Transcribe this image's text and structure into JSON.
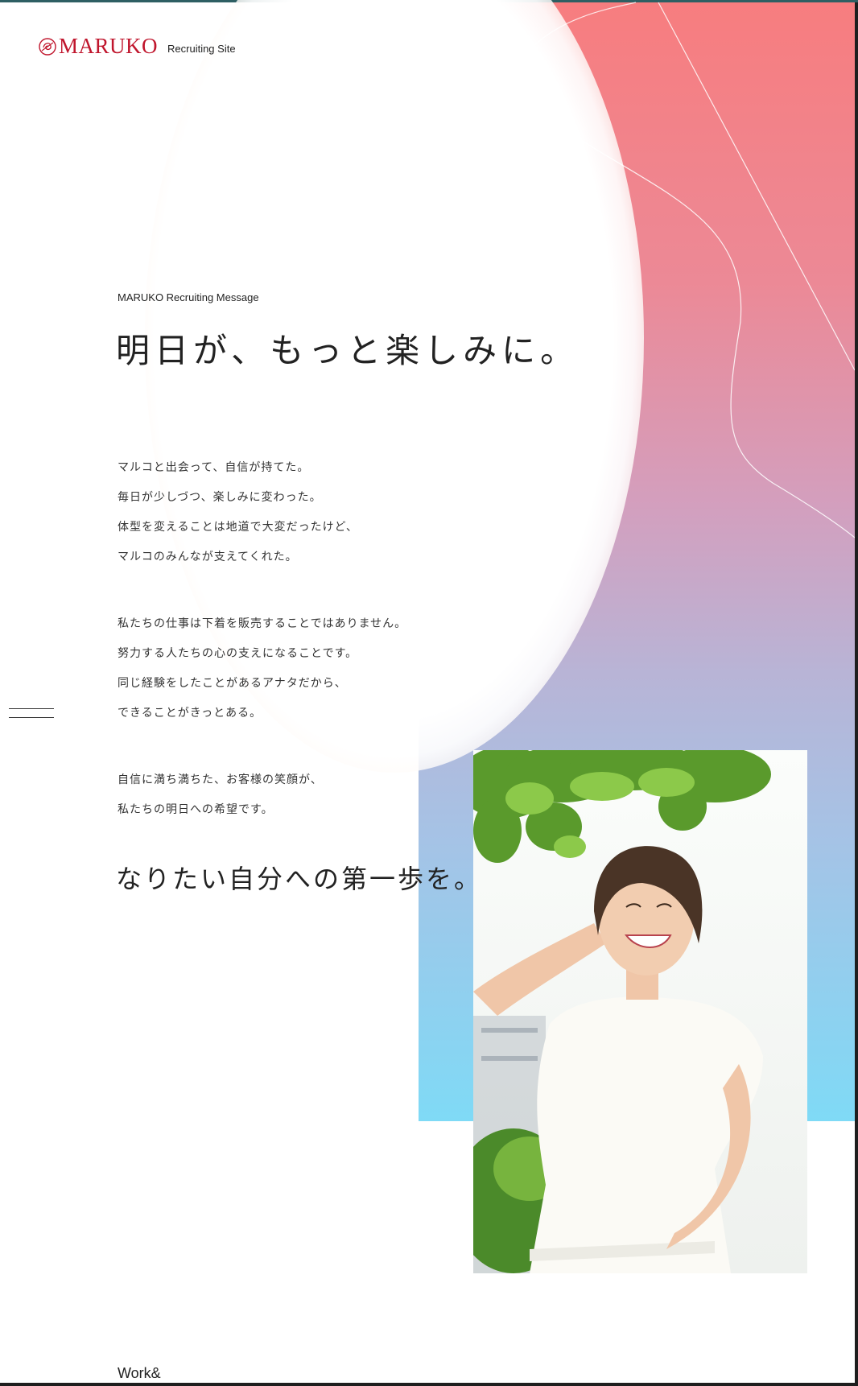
{
  "header": {
    "logo_text": "MARUKO",
    "logo_sub": "Recruiting Site",
    "brand_color": "#c0162d"
  },
  "hero": {
    "eyebrow": "MARUKO Recruiting Message",
    "headline": "明日が、もっと楽しみに。"
  },
  "message": {
    "paragraphs": [
      [
        "マルコと出会って、自信が持てた。",
        "毎日が少しづつ、楽しみに変わった。",
        "体型を変えることは地道で大変だったけど、",
        "マルコのみんなが支えてくれた。"
      ],
      [
        "私たちの仕事は下着を販売することではありません。",
        "努力する人たちの心の支えになることです。",
        "同じ経験をしたことがあるアナタだから、",
        "できることがきっとある。"
      ],
      [
        "自信に満ち満ちた、お客様の笑顔が、",
        "私たちの明日への希望です。"
      ]
    ],
    "closing": "なりたい自分への第一歩を。"
  },
  "footer": {
    "next_section": "Work&"
  },
  "icons": {
    "logo": "rose-logo-icon",
    "menu": "menu-icon"
  },
  "colors": {
    "gradient_top": "#f77d7f",
    "gradient_mid": "#d39fbe",
    "gradient_bottom": "#7fdaf6"
  }
}
